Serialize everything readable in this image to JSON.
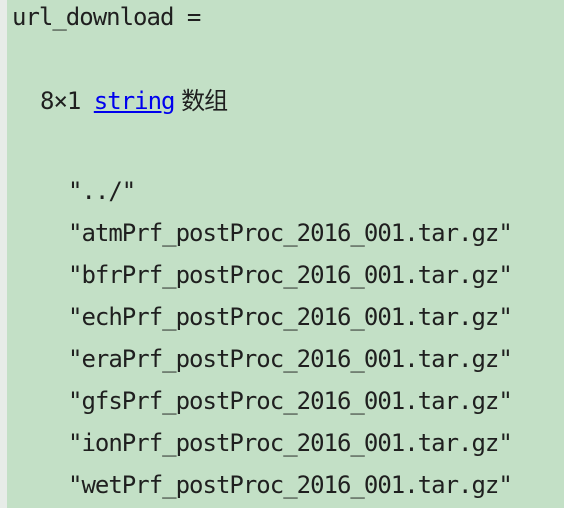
{
  "output": {
    "variable_line": "url_download =",
    "size_text": "8×1 ",
    "type_link": "string",
    "type_suffix": " 数组",
    "items": [
      "\"../\"",
      "\"atmPrf_postProc_2016_001.tar.gz\"",
      "\"bfrPrf_postProc_2016_001.tar.gz\"",
      "\"echPrf_postProc_2016_001.tar.gz\"",
      "\"eraPrf_postProc_2016_001.tar.gz\"",
      "\"gfsPrf_postProc_2016_001.tar.gz\"",
      "\"ionPrf_postProc_2016_001.tar.gz\"",
      "\"wetPrf_postProc_2016_001.tar.gz\""
    ]
  },
  "colors": {
    "background": "#c3e0c6",
    "link": "#0000ee",
    "text": "#1f1f1f"
  }
}
